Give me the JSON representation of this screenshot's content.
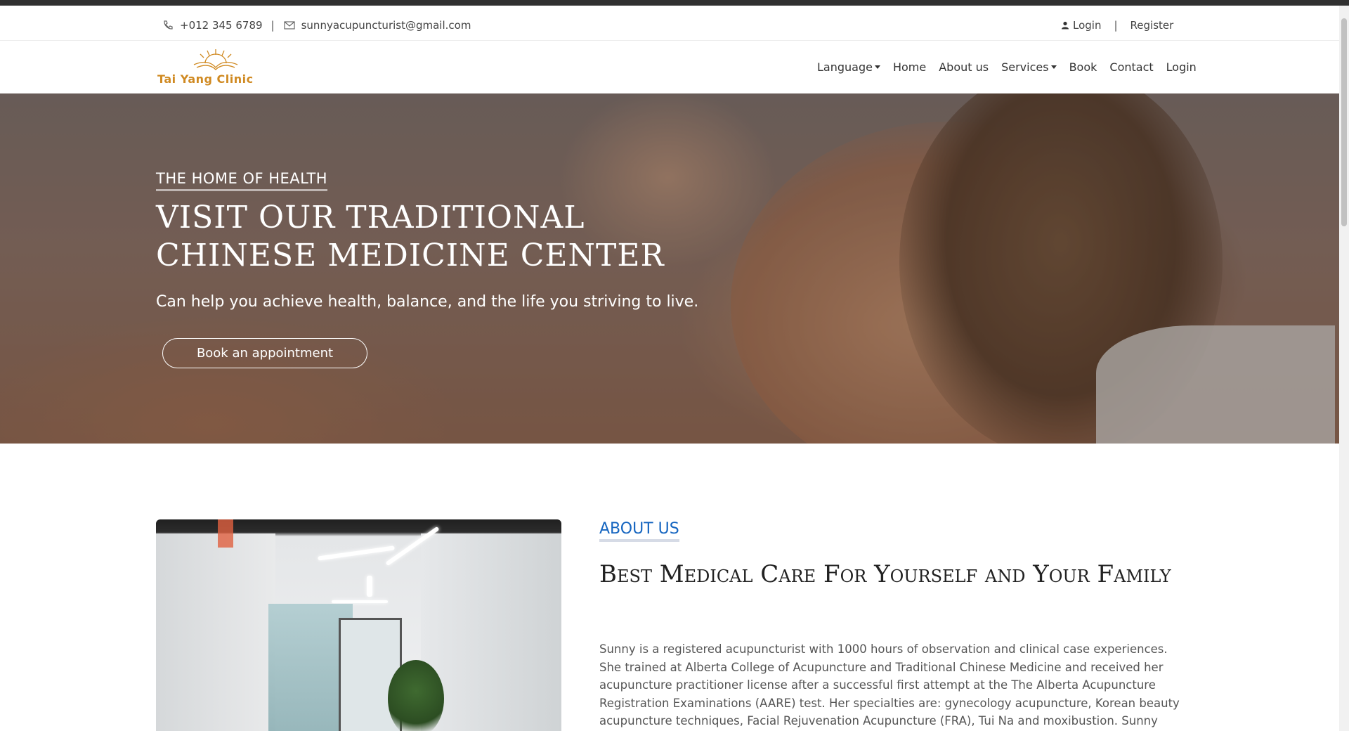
{
  "topbar": {
    "phone": "+012 345 6789",
    "separator": "|",
    "email": "sunnyacupuncturist@gmail.com",
    "login": "Login",
    "auth_separator": "|",
    "register": "Register"
  },
  "brand": {
    "name": "Tai Yang Clinic",
    "color": "#d08a22"
  },
  "nav": {
    "items": [
      {
        "label": "Language",
        "dropdown": true
      },
      {
        "label": "Home",
        "dropdown": false
      },
      {
        "label": "About us",
        "dropdown": false
      },
      {
        "label": "Services",
        "dropdown": true
      },
      {
        "label": "Book",
        "dropdown": false
      },
      {
        "label": "Contact",
        "dropdown": false
      },
      {
        "label": "Login",
        "dropdown": false
      }
    ]
  },
  "hero": {
    "eyebrow": "THE HOME OF HEALTH",
    "title_line1": "VISIT OUR TRADITIONAL",
    "title_line2": "CHINESE MEDICINE CENTER",
    "subtitle": "Can help you achieve health, balance, and the life you striving to live.",
    "cta": "Book an appointment"
  },
  "about": {
    "label": "ABOUT US",
    "title": "Best Medical Care For Yourself and Your Family",
    "body": "Sunny is a registered acupuncturist with 1000 hours of observation and clinical case experiences. She trained at Alberta College of Acupuncture and Traditional Chinese Medicine and received her acupuncture practitioner license after a successful first attempt at the The Alberta Acupuncture Registration Examinations (AARE) test. Her specialties are: gynecology acupuncture, Korean beauty acupuncture techniques, Facial Rejuvenation Acupuncture (FRA), Tui Na and moxibustion. Sunny actively attends educational conferences to",
    "accent_color": "#1565c0"
  }
}
